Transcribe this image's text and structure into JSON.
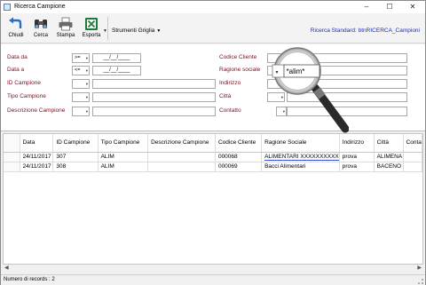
{
  "window": {
    "title": "Ricerca Campione",
    "minimize": "–",
    "maximize": "☐",
    "close": "✕"
  },
  "toolbar": {
    "chiudi": "Chiudi",
    "cerca": "Cerca",
    "stampa": "Stampa",
    "esporta": "Esporta",
    "strumenti": "Strumenti Griglia",
    "ricerca_standard": "Ricerca Standard: btnRICERCA_Campioni"
  },
  "form": {
    "data_da": {
      "label": "Data da",
      "operator": ">=",
      "value": "__/__/____"
    },
    "data_a": {
      "label": "Data a",
      "operator": "<=",
      "value": "__/__/____"
    },
    "id_campione": {
      "label": "ID Campione",
      "value": ""
    },
    "tipo_campione": {
      "label": "Tipo Campione",
      "value": ""
    },
    "descrizione_campione": {
      "label": "Descrizione Campione",
      "value": ""
    },
    "codice_cliente": {
      "label": "Codice Cliente",
      "value": ""
    },
    "ragione_sociale": {
      "label": "Ragione sociale",
      "value": "*alim*"
    },
    "indirizzo": {
      "label": "Indirizzo",
      "value": ""
    },
    "citta": {
      "label": "Città",
      "value": ""
    },
    "contatto": {
      "label": "Contatto",
      "value": ""
    }
  },
  "grid": {
    "columns": [
      "Data",
      "ID Campione",
      "Tipo Campione",
      "Descrizione Campione",
      "Codice Cliente",
      "Ragione Sociale",
      "Indirizzo",
      "Città",
      "Conta"
    ],
    "rows": [
      [
        "24/11/2017",
        "307",
        "ALIM",
        "",
        "000068",
        "ALIMENTARI XXXXXXXXXX",
        "prova",
        "ALIMENA",
        ""
      ],
      [
        "24/11/2017",
        "308",
        "ALIM",
        "",
        "000069",
        "Bacci Alimentari",
        "prova",
        "BACENO",
        ""
      ]
    ]
  },
  "status": {
    "records": "Numero di records : 2"
  }
}
